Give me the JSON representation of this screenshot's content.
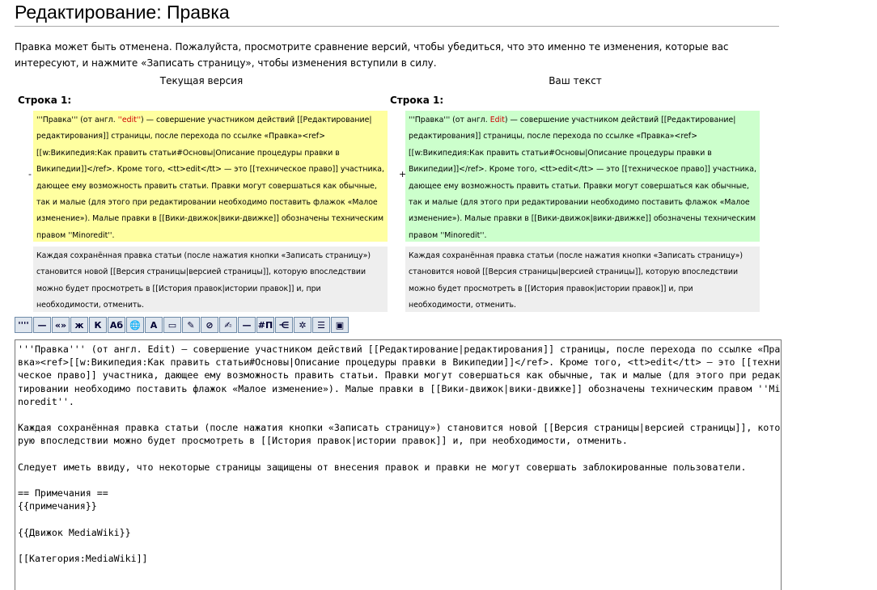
{
  "page": {
    "title": "Редактирование: Правка",
    "intro": "Правка может быть отменена. Пожалуйста, просмотрите сравнение версий, чтобы убедиться, что это именно те изменения, которые вас интересуют, и нажмите «Записать страницу», чтобы изменения вступили в силу."
  },
  "diff": {
    "left_header": "Текущая версия",
    "right_header": "Ваш текст",
    "left_line": "Строка 1:",
    "right_line": "Строка 1:",
    "minus": "-",
    "plus": "+",
    "left_para1": {
      "before": "'''Правка''' (от англ. ",
      "highlight": "''edit''",
      "after": ") — совершение участником действий [[Редактирование|редактирования]] страницы, после перехода по ссылке «Правка»<ref>[[w:Википедия:Как править статьи#Основы|Описание процедуры правки в Википедии]]</ref>. Кроме того, <tt>edit</tt> — это [[техническое право]] участника, дающее ему возможность править статьи. Правки могут совершаться как обычные, так и малые (для этого при редактировании необходимо поставить флажок «Малое изменение»). Малые правки в [[Вики-движок|вики-движке]] обозначены техническим правом ''Minoredit''."
    },
    "right_para1": {
      "before": "'''Правка''' (от англ. ",
      "highlight": "Edit",
      "after": ") — совершение участником действий [[Редактирование|редактирования]] страницы, после перехода по ссылке «Правка»<ref>[[w:Википедия:Как править статьи#Основы|Описание процедуры правки в Википедии]]</ref>. Кроме того, <tt>edit</tt> — это [[техническое право]] участника, дающее ему возможность править статьи. Правки могут совершаться как обычные, так и малые (для этого при редактировании необходимо поставить флажок «Малое изменение»). Малые правки в [[Вики-движок|вики-движке]] обозначены техническим правом ''Minoredit''."
    },
    "context_para": "Каждая сохранённая правка статьи (после нажатия кнопки «Записать страницу») становится новой [[Версия страницы|версией страницы]], которую впоследствии можно будет просмотреть в [[История правок|истории правок]] и, при необходимости, отменить."
  },
  "toolbar": {
    "buttons": [
      {
        "label": "''''",
        "icon": "quotes-icon"
      },
      {
        "label": "—",
        "icon": "dash-icon"
      },
      {
        "label": "«»",
        "icon": "guillemets-icon"
      },
      {
        "label": "ж",
        "icon": "bold-icon"
      },
      {
        "label": "К",
        "icon": "italic-icon"
      },
      {
        "label": "Аб",
        "icon": "link-icon"
      },
      {
        "label": "🌐",
        "icon": "external-link-icon"
      },
      {
        "label": "A",
        "icon": "headline-icon"
      },
      {
        "label": "▭",
        "icon": "image-icon"
      },
      {
        "label": "✎",
        "icon": "media-icon"
      },
      {
        "label": "⊘",
        "icon": "nowiki-icon"
      },
      {
        "label": "✍",
        "icon": "signature-icon"
      },
      {
        "label": "—",
        "icon": "horizontal-rule-icon"
      },
      {
        "label": "#П",
        "icon": "redirect-icon"
      },
      {
        "label": "⋲",
        "icon": "tree-icon"
      },
      {
        "label": "✲",
        "icon": "table-icon"
      },
      {
        "label": "☰",
        "icon": "gallery-icon"
      },
      {
        "label": "▣",
        "icon": "window-icon"
      }
    ]
  },
  "editor": {
    "content": "'''Правка''' (от англ. Edit) — совершение участником действий [[Редактирование|редактирования]] страницы, после перехода по ссылке «Правка»<ref>[[w:Википедия:Как править статьи#Основы|Описание процедуры правки в Википедии]]</ref>. Кроме того, <tt>edit</tt> — это [[техническое право]] участника, дающее ему возможность править статьи. Правки могут совершаться как обычные, так и малые (для этого при редактировании необходимо поставить флажок «Малое изменение»). Малые правки в [[Вики-движок|вики-движке]] обозначены техническим правом ''Minoredit''.\n\nКаждая сохранённая правка статьи (после нажатия кнопки «Записать страницу») становится новой [[Версия страницы|версией страницы]], которую впоследствии можно будет просмотреть в [[История правок|истории правок]] и, при необходимости, отменить.\n\nСледует иметь ввиду, что некоторые страницы защищены от внесения правок и правки не могут совершать заблокированные пользователи.\n\n== Примечания ==\n{{примечания}}\n\n{{Движок MediaWiki}}\n\n[[Категория:MediaWiki]]"
  }
}
